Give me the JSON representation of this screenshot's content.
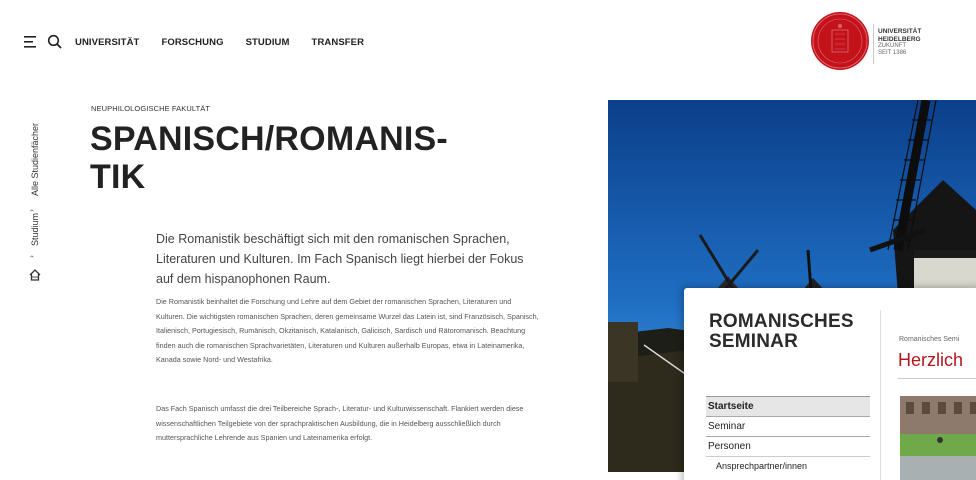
{
  "nav": {
    "items": [
      "UNIVERSITÄT",
      "FORSCHUNG",
      "STUDIUM",
      "TRANSFER"
    ]
  },
  "logo": {
    "line1": "UNIVERSITÄT",
    "line2": "HEIDELBERG",
    "line3": "ZUKUNFT",
    "line4": "SEIT 1386"
  },
  "breadcrumb": {
    "level1": "Alle Studienfächer",
    "level2": "Studium"
  },
  "content": {
    "kicker": "NEUPHILOLOGISCHE FAKULTÄT",
    "title_line1": "SPANISCH/ROMANIS-",
    "title_line2": "TIK",
    "lead": "Die Romanistik beschäftigt sich mit den romanischen Sprachen, Literaturen und Kulturen. Im Fach Spanisch liegt hierbei der Fokus auf dem hispanophonen Raum.",
    "body1": "Die Romanistik beinhaltet die Forschung und Lehre auf dem Gebiet der romanischen Sprachen, Literaturen und Kulturen. Die wichtigsten romanischen Sprachen, deren gemeinsame Wurzel das Latein ist, sind Französisch, Spanisch, Italienisch, Portugiesisch, Rumänisch, Okzitanisch, Katalanisch, Galicisch, Sardisch und Rätoromanisch. Beachtung finden auch die romanischen Sprachvarietäten, Literaturen und Kulturen außerhalb Europas, etwa in Lateinamerika, Kanada sowie Nord- und Westafrika.",
    "body2": "Das Fach Spanisch umfasst die drei Teilbereiche Sprach-, Literatur- und Kulturwissenschaft. Flankiert werden diese wissenschaftlichen Teilgebiete von der sprachpraktischen Ausbildung, die in Heidelberg ausschließlich durch muttersprachliche Lehrende aus Spanien und Lateinamerika erfolgt."
  },
  "seminar": {
    "title_line1": "ROMANISCHES",
    "title_line2": "SEMINAR",
    "crumb": "Romanisches Semi",
    "heading": "Herzlich",
    "nav": [
      "Startseite",
      "Seminar",
      "Personen",
      "Ansprechpartner/innen"
    ]
  },
  "colors": {
    "brand_red": "#c4121b",
    "heading_red": "#b3151d",
    "sky_blue": "#0d4e9b"
  }
}
